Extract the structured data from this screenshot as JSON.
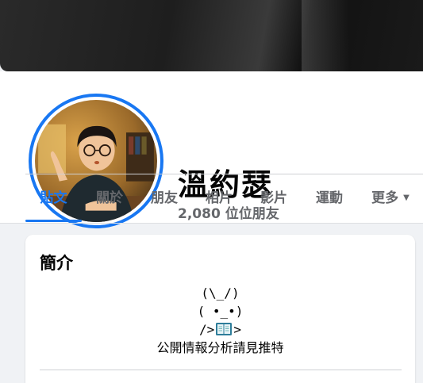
{
  "profile": {
    "name": "溫約瑟",
    "friends_count": "2,080 位位朋友"
  },
  "tabs": [
    {
      "label": "貼文",
      "active": true
    },
    {
      "label": "關於",
      "active": false
    },
    {
      "label": "朋友",
      "active": false
    },
    {
      "label": "相片",
      "active": false
    },
    {
      "label": "影片",
      "active": false
    },
    {
      "label": "運動",
      "active": false
    },
    {
      "label": "更多",
      "active": false
    }
  ],
  "intro": {
    "title": "簡介",
    "bio_lines": [
      "(\\_/)",
      "( •_•)",
      "/>",
      ">",
      "公開情報分析請見推特"
    ]
  },
  "colors": {
    "accent": "#1877f2",
    "muted_text": "#65676b",
    "page_bg": "#f0f2f5"
  },
  "icons": [
    "book-emoji-icon",
    "caret-down-icon"
  ]
}
